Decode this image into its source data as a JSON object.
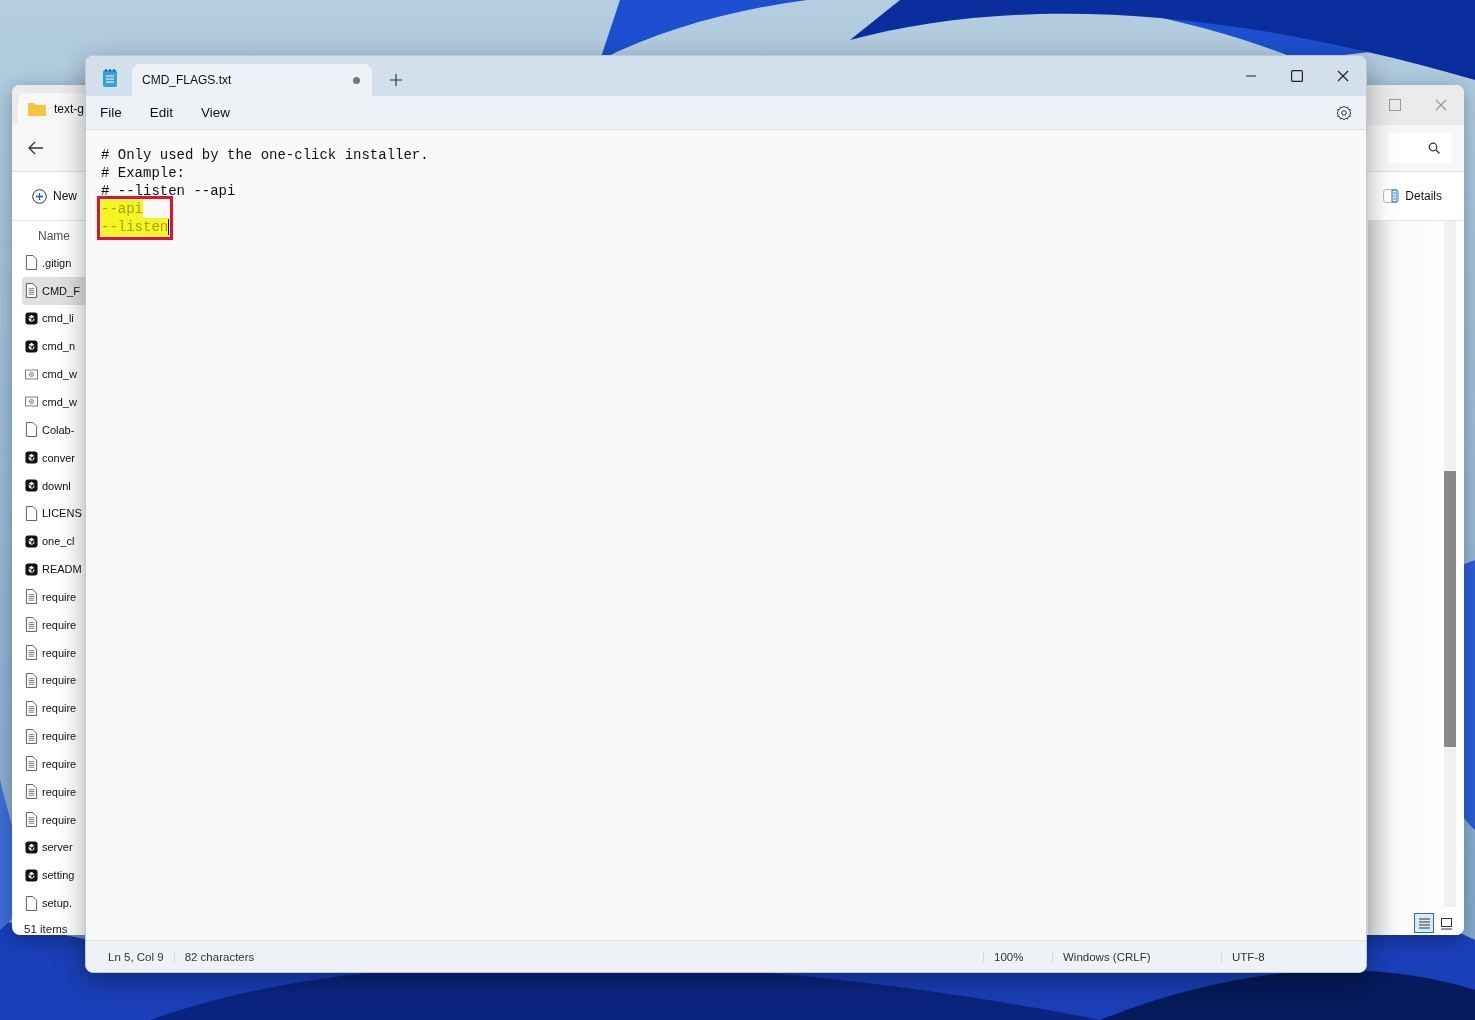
{
  "explorer": {
    "tab_title": "text-g",
    "new_label": "New",
    "details_label": "Details",
    "column_header": "Name",
    "files": [
      {
        "name": ".gitign",
        "kind": "blank",
        "selected": false
      },
      {
        "name": "CMD_F",
        "kind": "text",
        "selected": true
      },
      {
        "name": "cmd_li",
        "kind": "python",
        "selected": false
      },
      {
        "name": "cmd_n",
        "kind": "python",
        "selected": false
      },
      {
        "name": "cmd_w",
        "kind": "batch",
        "selected": false
      },
      {
        "name": "cmd_w",
        "kind": "batch",
        "selected": false
      },
      {
        "name": "Colab-",
        "kind": "blank",
        "selected": false
      },
      {
        "name": "conver",
        "kind": "python",
        "selected": false
      },
      {
        "name": "downl",
        "kind": "python",
        "selected": false
      },
      {
        "name": "LICENS",
        "kind": "blank",
        "selected": false
      },
      {
        "name": "one_cl",
        "kind": "python",
        "selected": false
      },
      {
        "name": "READM",
        "kind": "python",
        "selected": false
      },
      {
        "name": "require",
        "kind": "text",
        "selected": false
      },
      {
        "name": "require",
        "kind": "text",
        "selected": false
      },
      {
        "name": "require",
        "kind": "text",
        "selected": false
      },
      {
        "name": "require",
        "kind": "text",
        "selected": false
      },
      {
        "name": "require",
        "kind": "text",
        "selected": false
      },
      {
        "name": "require",
        "kind": "text",
        "selected": false
      },
      {
        "name": "require",
        "kind": "text",
        "selected": false
      },
      {
        "name": "require",
        "kind": "text",
        "selected": false
      },
      {
        "name": "require",
        "kind": "text",
        "selected": false
      },
      {
        "name": "server",
        "kind": "python",
        "selected": false
      },
      {
        "name": "setting",
        "kind": "python",
        "selected": false
      },
      {
        "name": "setup.",
        "kind": "blank",
        "selected": false
      }
    ],
    "item_count": "51 items",
    "views": [
      {
        "kind": "details",
        "selected": true
      },
      {
        "kind": "tiles",
        "selected": false
      }
    ]
  },
  "notepad": {
    "tab": {
      "title": "CMD_FLAGS.txt",
      "modified": true
    },
    "menu": [
      "File",
      "Edit",
      "View"
    ],
    "lines": [
      {
        "text": "# Only used by the one-click installer.",
        "highlighted": false,
        "boxed": false,
        "cursor": false
      },
      {
        "text": "# Example:",
        "highlighted": false,
        "boxed": false,
        "cursor": false
      },
      {
        "text": "# --listen --api",
        "highlighted": false,
        "boxed": false,
        "cursor": false
      },
      {
        "text": "--api",
        "highlighted": true,
        "boxed": true,
        "cursor": false
      },
      {
        "text": "--listen",
        "highlighted": true,
        "boxed": true,
        "cursor": true
      }
    ],
    "status": [
      "Ln 5, Col 9",
      "82 characters",
      "100%",
      "Windows (CRLF)",
      "UTF-8"
    ]
  }
}
